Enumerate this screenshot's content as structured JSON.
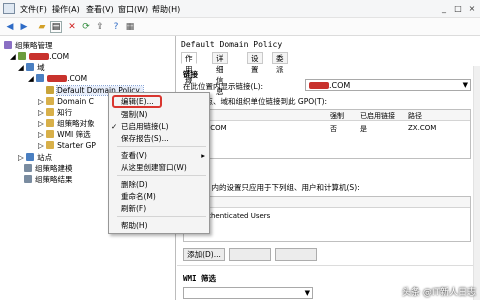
{
  "menubar": {
    "items": [
      "文件(F)",
      "操作(A)",
      "查看(V)",
      "窗口(W)",
      "帮助(H)"
    ],
    "window_controls": [
      "_",
      "□",
      "×"
    ]
  },
  "toolbar": {
    "icons": [
      "back-icon",
      "forward-icon",
      "folder-icon",
      "show-tree-icon",
      "delete-icon",
      "refresh-icon",
      "export-icon",
      "help-icon",
      "properties-icon"
    ]
  },
  "tree": {
    "root": "组策略管理",
    "forest": ".COM",
    "domains": "域",
    "domain": ".COM",
    "policy": "Default Domain Policy",
    "items": [
      "Domain C",
      "知行",
      "组策略对象",
      "WMI 筛选",
      "Starter GP"
    ],
    "sites": "站点",
    "modeling": "组策略建模",
    "results": "组策略结果"
  },
  "context_menu": {
    "items": [
      "编辑(E)...",
      "强制(N)",
      "已启用链接(L)",
      "保存报告(S)...",
      "查看(V)",
      "从这里创建窗口(W)",
      "删除(D)",
      "重命名(M)",
      "刷新(F)",
      "帮助(H)"
    ],
    "checked_item": "已启用链接(L)",
    "submenu_arrow": "▸",
    "checkmark": "✓"
  },
  "right": {
    "title": "Default Domain Policy",
    "tabs": [
      "作用域",
      "详细信息",
      "设置",
      "委派"
    ],
    "links_header": "链接",
    "location_label": "在此位置内显示链接(L):",
    "location_value": ".COM",
    "linked_text": "下列站点、域和组织单位链接到此 GPO(T):",
    "columns": [
      "位置",
      "强制",
      "已启用链接",
      "路径"
    ],
    "rows": [
      {
        "location": ".COM",
        "enforced": "否",
        "enabled": "是",
        "path": "ZX.COM"
      }
    ],
    "filter_text": "此 GPO 内的设置只应用于下列组、用户和计算机(S):",
    "security_group": "Authenticated Users",
    "add_button": "添加(D)...",
    "wmi_header": "WMI 筛选"
  },
  "watermark": "头条 @IT新人日志",
  "colors": {
    "redaction": "#c8322d",
    "highlight_border": "#d9362f"
  }
}
